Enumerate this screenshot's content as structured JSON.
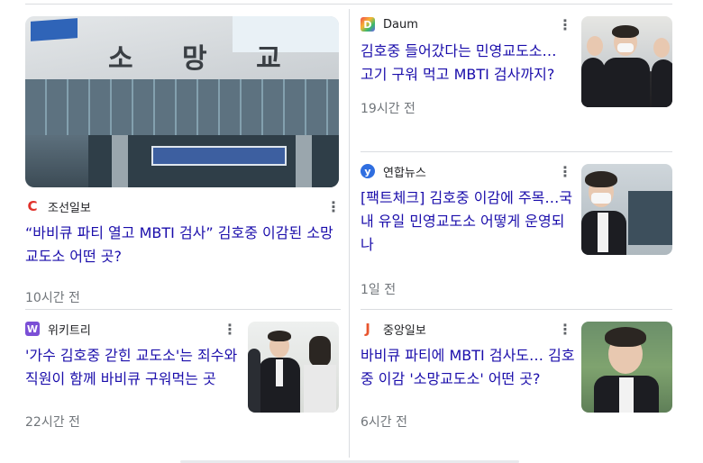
{
  "cards": [
    {
      "source": "조선일보",
      "logo_icon": "chosun-logo-icon",
      "logo_color": "#e0312b",
      "headline": "“바비큐 파티 열고 MBTI 검사” 김호중 이감된 소망교도소 어떤 곳?",
      "time": "10시간 전",
      "image_sign": "소 망 교 도 소"
    },
    {
      "source": "Daum",
      "logo_icon": "daum-logo-icon",
      "logo_color": "#6f5cf0",
      "headline": "김호중 들어갔다는 민영교도소…고기 구워 먹고 MBTI 검사까지?",
      "time": "19시간 전"
    },
    {
      "source": "연합뉴스",
      "logo_icon": "yonhap-logo-icon",
      "logo_color": "#2f6ee0",
      "headline": "[팩트체크] 김호중 이감에 주목…국내 유일 민영교도소 어떻게 운영되나",
      "time": "1일 전"
    },
    {
      "source": "위키트리",
      "logo_icon": "wikitree-logo-icon",
      "logo_color": "#7b4fd6",
      "headline": "'가수 김호중 갇힌 교도소'는 죄수와 직원이 함께 바비큐 구워먹는 곳",
      "time": "22시간 전"
    },
    {
      "source": "중앙일보",
      "logo_icon": "joongang-logo-icon",
      "logo_color": "#e8552e",
      "headline": "바비큐 파티에 MBTI 검사도… 김호중 이감 '소망교도소' 어떤 곳?",
      "time": "6시간 전"
    }
  ],
  "menu_icon": "more-vert-icon"
}
